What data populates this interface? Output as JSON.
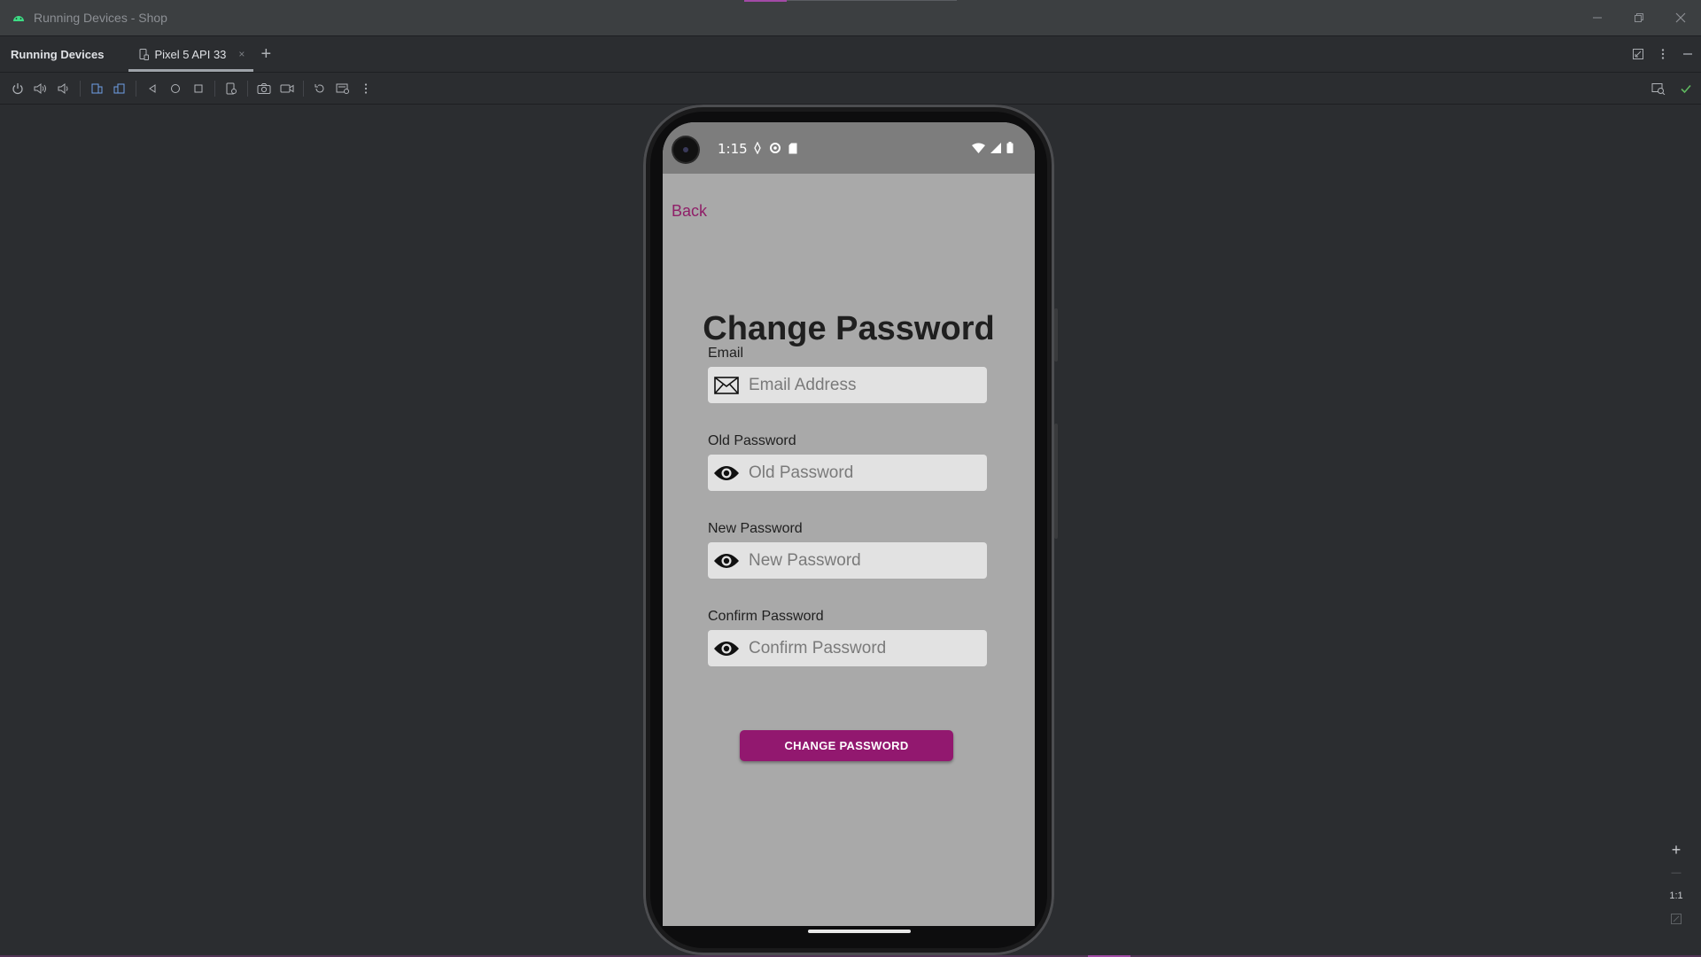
{
  "window": {
    "title": "Running Devices - Shop"
  },
  "tool_window": {
    "title": "Running Devices",
    "tabs": [
      {
        "label": "Pixel 5 API 33",
        "close_label": "×"
      }
    ],
    "add_tab_label": "+"
  },
  "toolbar": {
    "icons": [
      "power-icon",
      "volume-up-icon",
      "volume-down-icon",
      "rotate-left-icon",
      "rotate-right-icon",
      "back-icon",
      "home-icon",
      "overview-icon",
      "device-icon",
      "screenshot-icon",
      "screen-record-icon",
      "reset-icon",
      "extended-controls-icon",
      "more-icon"
    ]
  },
  "device": {
    "status_bar": {
      "time": "1:15"
    },
    "app": {
      "back_label": "Back",
      "heading": "Change Password",
      "fields": [
        {
          "label": "Email",
          "placeholder": "Email Address",
          "icon": "envelope-icon"
        },
        {
          "label": "Old Password",
          "placeholder": "Old Password",
          "icon": "eye-icon"
        },
        {
          "label": "New Password",
          "placeholder": "New Password",
          "icon": "eye-icon"
        },
        {
          "label": "Confirm Password",
          "placeholder": "Confirm Password",
          "icon": "eye-icon"
        }
      ],
      "submit_label": "CHANGE PASSWORD"
    }
  },
  "zoom": {
    "plus": "+",
    "minus": "—",
    "actual_size": "1:1"
  },
  "colors": {
    "accent": "#92186f",
    "link": "#8f1f68",
    "screen_bg": "#a9a9a9",
    "ide_bg": "#2b2d30"
  }
}
